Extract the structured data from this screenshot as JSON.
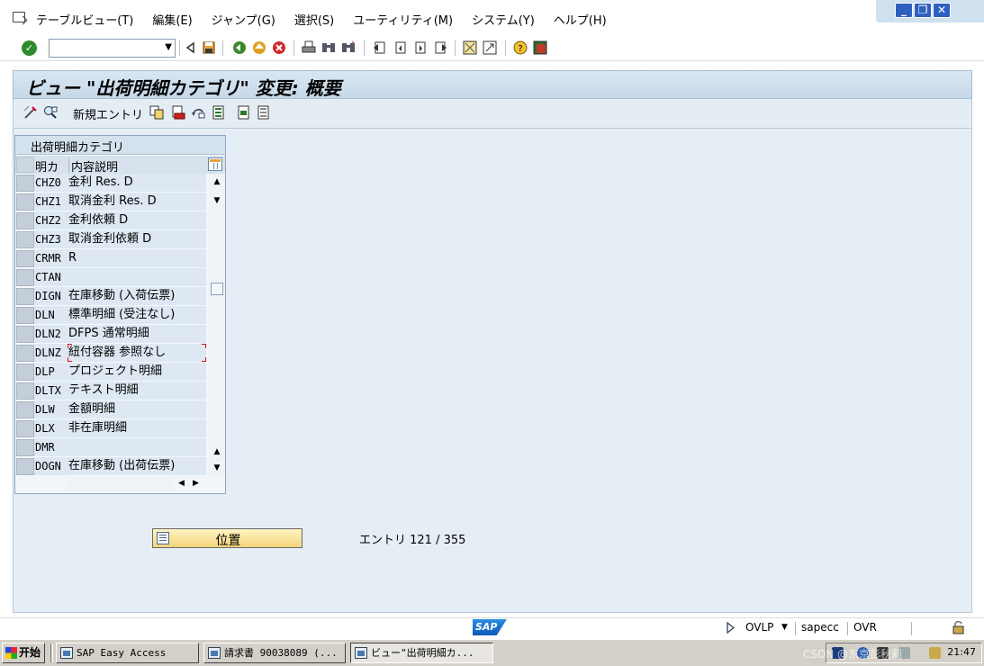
{
  "menubar": {
    "items": [
      "テーブルビュー(T)",
      "編集(E)",
      "ジャンプ(G)",
      "選択(S)",
      "ユーティリティ(M)",
      "システム(Y)",
      "ヘルプ(H)"
    ],
    "window_controls": [
      "minimize",
      "restore",
      "close"
    ]
  },
  "toolbar": {
    "command_field": "",
    "icons": [
      "enter-check-icon",
      "back-triangle-icon",
      "save-icon",
      "back-icon",
      "exit-icon",
      "cancel-icon",
      "print-icon",
      "find-icon",
      "find-next-icon",
      "first-page-icon",
      "previous-page-icon",
      "next-page-icon",
      "last-page-icon",
      "create-session-icon",
      "shortcut-icon",
      "help-icon",
      "customize-layout-icon"
    ]
  },
  "screen": {
    "title": "ビュー \"出荷明細カテゴリ\" 変更: 概要",
    "app_toolbar": {
      "new_entries": "新規エントリ",
      "icons": [
        "display-change-icon",
        "other-view-icon",
        "copy-as-icon",
        "delete-icon",
        "undo-change-icon",
        "select-all-icon",
        "select-block-icon",
        "deselect-all-icon"
      ]
    },
    "table": {
      "title": "出荷明細カテゴリ",
      "columns": [
        "明カ",
        "内容説明"
      ],
      "rows": [
        {
          "code": "CHZ0",
          "desc": "金利 Res. D"
        },
        {
          "code": "CHZ1",
          "desc": "取消金利 Res. D"
        },
        {
          "code": "CHZ2",
          "desc": "金利依頼 D"
        },
        {
          "code": "CHZ3",
          "desc": "取消金利依頼 D"
        },
        {
          "code": "CRMR",
          "desc": "R"
        },
        {
          "code": "CTAN",
          "desc": ""
        },
        {
          "code": "DIGN",
          "desc": "在庫移動 (入荷伝票)"
        },
        {
          "code": "DLN",
          "desc": "標準明細 (受注なし)"
        },
        {
          "code": "DLN2",
          "desc": "DFPS 通常明細"
        },
        {
          "code": "DLNZ",
          "desc": "紐付容器 参照なし"
        },
        {
          "code": "DLP",
          "desc": "プロジェクト明細"
        },
        {
          "code": "DLTX",
          "desc": "テキスト明細"
        },
        {
          "code": "DLW",
          "desc": "金額明細"
        },
        {
          "code": "DLX",
          "desc": "非在庫明細"
        },
        {
          "code": "DMR",
          "desc": ""
        },
        {
          "code": "DOGN",
          "desc": "在庫移動 (出荷伝票)"
        }
      ],
      "focused_row": 9
    },
    "position_button": "位置",
    "entry_info": "エントリ 121 / 355"
  },
  "statusbar": {
    "logo": "SAP",
    "mode": "OVLP",
    "server": "sapecc",
    "insert_mode": "OVR"
  },
  "taskbar": {
    "start": "开始",
    "tasks": [
      "SAP Easy Access",
      "請求書 90038089 (...",
      "ビュー\"出荷明細カ..."
    ],
    "active_task": 2,
    "clock": "21:47",
    "watermark": "CSDN @东京彭秋莉"
  },
  "colors": {
    "title_bg": "#c9dbe9",
    "content_bg": "#e6eef5",
    "row_bg": "#dde8f2",
    "position_button_bg": "#f6dc8a",
    "taskbar_bg": "#d4d0c8"
  }
}
